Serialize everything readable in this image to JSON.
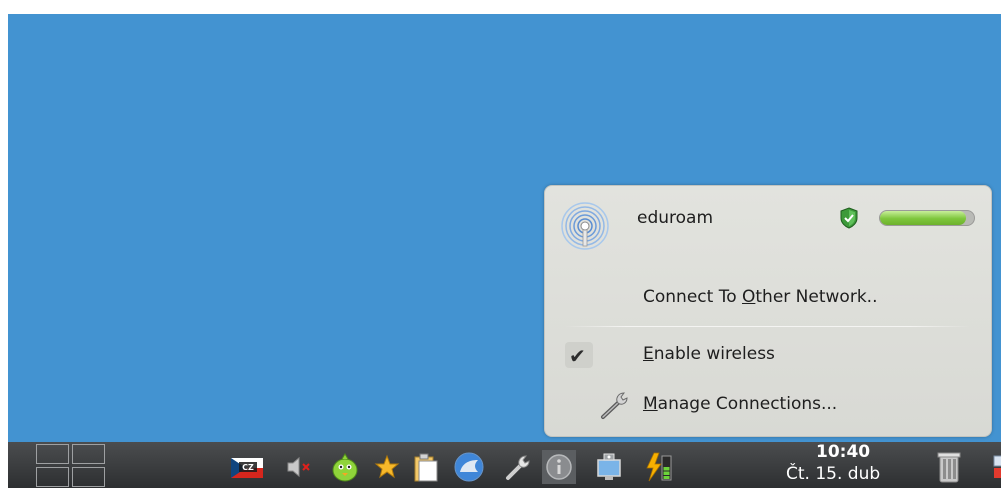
{
  "network_popup": {
    "network_name": "eduroam",
    "signal_level": 0.92,
    "connect_other_label": {
      "prefix": "Connect To ",
      "accel": "O",
      "suffix": "ther Network.."
    },
    "enable_wireless_label": {
      "prefix": "",
      "accel": "E",
      "suffix": "nable wireless"
    },
    "enable_wireless_checked": true,
    "manage_connections_label": {
      "prefix": "",
      "accel": "M",
      "suffix": "anage Connections..."
    }
  },
  "taskbar": {
    "keyboard_layout": "CZ",
    "clock_time": "10:40",
    "clock_date": "Čt. 15. dub"
  },
  "colors": {
    "desktop": "#4393d1",
    "popup_bg": "#dcddd8",
    "signal": "#7ec63c",
    "taskbar": "#3a3c3e"
  },
  "icons": {
    "tray": [
      "cz-flag-icon",
      "volume-muted-icon",
      "messenger-bird-icon",
      "star-icon",
      "clipboard-icon",
      "wolf-globe-icon",
      "wrench-small-icon",
      "info-icon",
      "network-monitor-icon",
      "battery-power-icon"
    ],
    "system": [
      "trash-icon"
    ]
  }
}
